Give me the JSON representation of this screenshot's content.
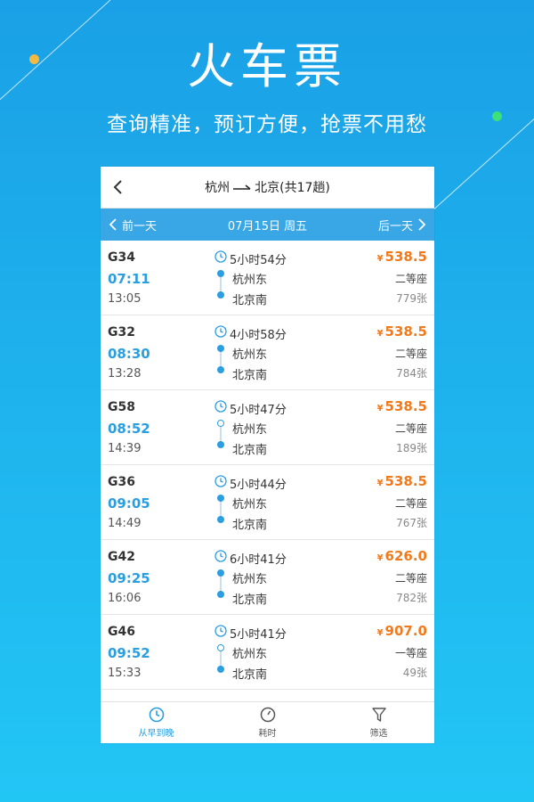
{
  "hero": {
    "title": "火车票",
    "subtitle": "查询精准，预订方便，抢票不用愁"
  },
  "colors": {
    "accent": "#2b9ee0",
    "datebar": "#39a7e6",
    "price": "#f07a1c",
    "dot_orange": "#f5b942",
    "dot_green": "#3ee07a"
  },
  "nav": {
    "from": "杭州",
    "to": "北京(共17趟)"
  },
  "datebar": {
    "prev": "前一天",
    "date": "07月15日 周五",
    "next": "后一天"
  },
  "trains": [
    {
      "train": "G34",
      "dep": "07:11",
      "arr": "13:05",
      "duration": "5小时54分",
      "from": "杭州东",
      "to": "北京南",
      "price": "538.5",
      "seat": "二等座",
      "count": "779张",
      "hollow": false
    },
    {
      "train": "G32",
      "dep": "08:30",
      "arr": "13:28",
      "duration": "4小时58分",
      "from": "杭州东",
      "to": "北京南",
      "price": "538.5",
      "seat": "二等座",
      "count": "784张",
      "hollow": false
    },
    {
      "train": "G58",
      "dep": "08:52",
      "arr": "14:39",
      "duration": "5小时47分",
      "from": "杭州东",
      "to": "北京南",
      "price": "538.5",
      "seat": "二等座",
      "count": "189张",
      "hollow": true
    },
    {
      "train": "G36",
      "dep": "09:05",
      "arr": "14:49",
      "duration": "5小时44分",
      "from": "杭州东",
      "to": "北京南",
      "price": "538.5",
      "seat": "二等座",
      "count": "767张",
      "hollow": false
    },
    {
      "train": "G42",
      "dep": "09:25",
      "arr": "16:06",
      "duration": "6小时41分",
      "from": "杭州东",
      "to": "北京南",
      "price": "626.0",
      "seat": "二等座",
      "count": "782张",
      "hollow": false
    },
    {
      "train": "G46",
      "dep": "09:52",
      "arr": "15:33",
      "duration": "5小时41分",
      "from": "杭州东",
      "to": "北京南",
      "price": "907.0",
      "seat": "一等座",
      "count": "49张",
      "hollow": true
    }
  ],
  "currency": "¥",
  "tabs": [
    {
      "label": "从早到晚",
      "icon": "clock-icon",
      "active": true
    },
    {
      "label": "耗时",
      "icon": "timer-icon",
      "active": false
    },
    {
      "label": "筛选",
      "icon": "filter-icon",
      "active": false
    }
  ]
}
